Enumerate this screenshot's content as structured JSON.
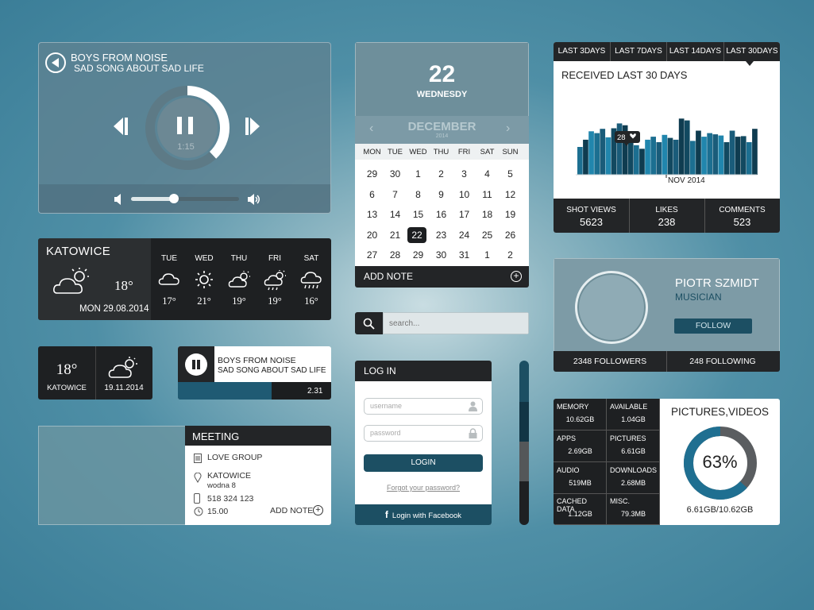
{
  "player": {
    "artist": "BOYS FROM NOISE",
    "song": "SAD SONG ABOUT SAD LIFE",
    "time": "1:15",
    "progress": 0.38,
    "volume": 0.4
  },
  "weather": {
    "city": "KATOWICE",
    "temp": "18°",
    "date": "MON 29.08.2014",
    "forecast": [
      {
        "day": "TUE",
        "temp": "17°",
        "icon": "cloud-icon"
      },
      {
        "day": "WED",
        "temp": "21°",
        "icon": "sun-icon"
      },
      {
        "day": "THU",
        "temp": "19°",
        "icon": "partly-cloudy-icon"
      },
      {
        "day": "FRI",
        "temp": "19°",
        "icon": "rain-sun-icon"
      },
      {
        "day": "SAT",
        "temp": "16°",
        "icon": "rain-icon"
      }
    ]
  },
  "weather_small": {
    "temp": "18°",
    "city": "KATOWICE",
    "date": "19.11.2014"
  },
  "mini_player": {
    "artist": "BOYS FROM NOISE",
    "song": "SAD SONG ABOUT SAD LIFE",
    "time": "2.31",
    "progress": 0.61
  },
  "meeting": {
    "title": "MEETING",
    "group": "LOVE GROUP",
    "city": "KATOWICE",
    "street": "wodna 8",
    "phone": "518 324 123",
    "time": "15.00",
    "add_note": "ADD NOTE"
  },
  "calendar": {
    "day": "22",
    "weekday": "WEDNESDY",
    "month": "DECEMBER",
    "year": "2014",
    "weekdays": [
      "MON",
      "TUE",
      "WED",
      "THU",
      "FRI",
      "SAT",
      "SUN"
    ],
    "weeks": [
      [
        "29",
        "30",
        "1",
        "2",
        "3",
        "4",
        "5"
      ],
      [
        "6",
        "7",
        "8",
        "9",
        "10",
        "11",
        "12"
      ],
      [
        "13",
        "14",
        "15",
        "16",
        "17",
        "18",
        "19"
      ],
      [
        "20",
        "21",
        "22",
        "23",
        "24",
        "25",
        "26"
      ],
      [
        "27",
        "28",
        "29",
        "30",
        "31",
        "1",
        "2"
      ]
    ],
    "selected": "22",
    "add_note": "ADD NOTE"
  },
  "search": {
    "placeholder": "search..."
  },
  "login": {
    "title": "LOG IN",
    "username_placeholder": "username",
    "password_placeholder": "password",
    "button": "LOGIN",
    "forgot": "Forgot your password?",
    "facebook": "Login with Facebook"
  },
  "stats": {
    "tabs": [
      "LAST 3DAYS",
      "LAST 7DAYS",
      "LAST 14DAYS",
      "LAST 30DAYS"
    ],
    "active_tab": "LAST 30DAYS",
    "title": "RECEIVED LAST 30 DAYS",
    "tooltip": "28",
    "month_label": "NOV 2014",
    "footer": [
      {
        "label": "SHOT VIEWS",
        "value": "5623"
      },
      {
        "label": "LIKES",
        "value": "238"
      },
      {
        "label": "COMMENTS",
        "value": "523"
      }
    ]
  },
  "chart_data": {
    "type": "bar",
    "values": [
      46,
      58,
      72,
      69,
      76,
      62,
      77,
      85,
      82,
      70,
      49,
      43,
      58,
      63,
      54,
      66,
      61,
      58,
      93,
      90,
      56,
      73,
      63,
      69,
      67,
      65,
      54,
      73,
      63,
      64,
      54,
      76
    ],
    "colors": [
      "#1c6f91",
      "#2186ad",
      "#1a5c7a",
      "#124960",
      "#0f3c50"
    ]
  },
  "profile": {
    "name": "PIOTR SZMIDT",
    "role": "MUSICIAN",
    "follow": "FOLLOW",
    "followers": "2348   FOLLOWERS",
    "following": "248   FOLLOWING"
  },
  "storage": {
    "cells": [
      {
        "label": "MEMORY",
        "value": "10.62GB"
      },
      {
        "label": "AVAILABLE",
        "value": "1.04GB"
      },
      {
        "label": "APPS",
        "value": "2.69GB"
      },
      {
        "label": "PICTURES",
        "value": "6.61GB"
      },
      {
        "label": "AUDIO",
        "value": "519MB"
      },
      {
        "label": "DOWNLOADS",
        "value": "2.68MB"
      },
      {
        "label": "CACHED DATA",
        "value": "1.12GB"
      },
      {
        "label": "MISC.",
        "value": "79.3MB"
      }
    ],
    "title": "PICTURES,VIDEOS",
    "percent": "63%",
    "fraction": 0.63,
    "used": "6.61GB/10.62GB"
  }
}
